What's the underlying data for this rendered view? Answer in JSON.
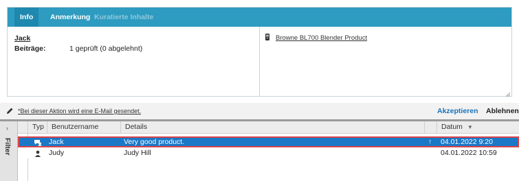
{
  "tabs": [
    {
      "label": "Info",
      "state": "active"
    },
    {
      "label": "Anmerkung",
      "state": "normal"
    },
    {
      "label": "Kuratierte Inhalte",
      "state": "disabled"
    }
  ],
  "info": {
    "user_name": "Jack",
    "contributions_label": "Beiträge:",
    "contributions_value": "1 geprüft (0 abgelehnt)",
    "product_icon": "product-box-icon",
    "product_name": "Browne BL700 Blender Product"
  },
  "actions": {
    "pencil_icon": "pencil-icon",
    "note": "*Bei dieser Aktion wird eine E-Mail gesendet.",
    "accept_label": "Akzeptieren",
    "reject_label": "Ablehnen*"
  },
  "filter": {
    "label": "Filter",
    "collapse_arrow": "›"
  },
  "grid": {
    "columns": {
      "type": "Typ",
      "username": "Benutzername",
      "details": "Details",
      "date": "Datum",
      "date_sort_icon": "sort-desc-icon"
    },
    "rows": [
      {
        "type_icon": "review-user-icon",
        "username": "Jack",
        "details": "Very good product.",
        "marker": "↑",
        "date": "04.01.2022 9:20",
        "selected": true
      },
      {
        "type_icon": "user-icon",
        "username": "Judy",
        "details": "Judy Hill",
        "marker": "",
        "date": "04.01.2022 10:59",
        "selected": false
      }
    ]
  },
  "colors": {
    "tabbar": "#2e9bc0",
    "selected_row": "#1a78c6",
    "selection_outline": "#d9434a",
    "accept": "#1a72b8"
  }
}
